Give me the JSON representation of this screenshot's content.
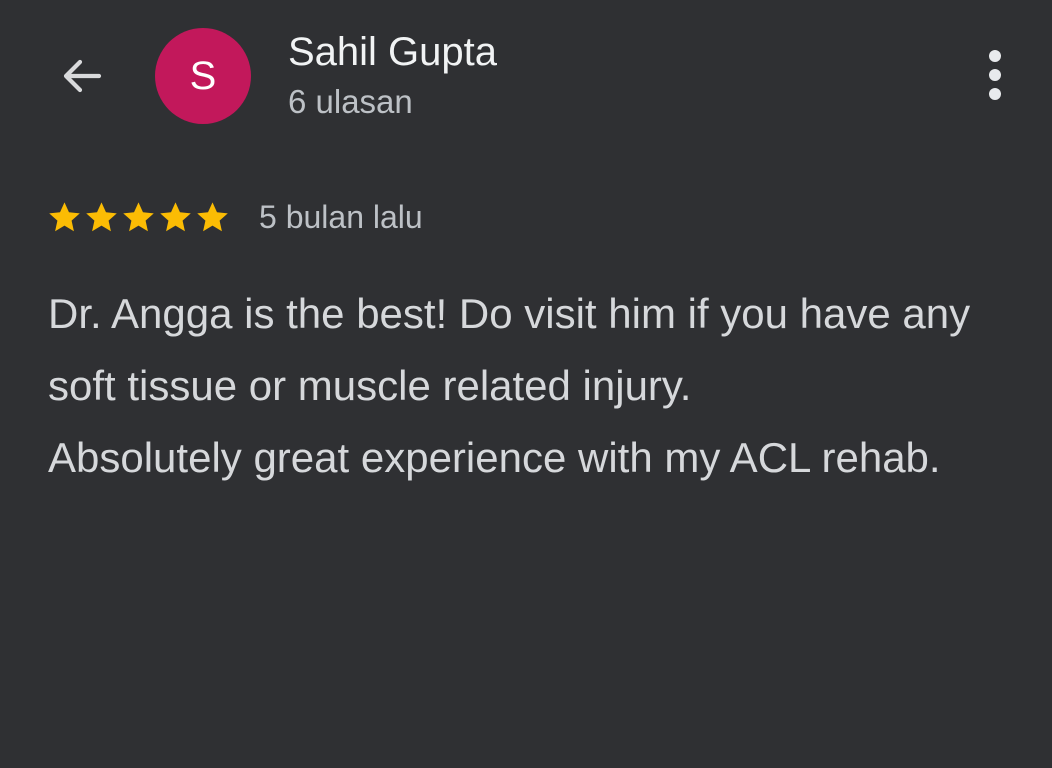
{
  "header": {
    "back_icon": "arrow-left-icon",
    "avatar_initial": "S",
    "avatar_color": "#c2185b",
    "name": "Sahil Gupta",
    "review_count": "6 ulasan",
    "menu_icon": "more-vertical-icon"
  },
  "review": {
    "rating": 5,
    "max_rating": 5,
    "star_color": "#fbbc04",
    "date": "5 bulan lalu",
    "paragraphs": [
      "Dr. Angga is the best! Do visit him if you have any soft tissue or muscle related injury.",
      "Absolutely great experience with my ACL rehab."
    ]
  },
  "theme": {
    "background": "#2f3033",
    "primary_text": "#f1f3f4",
    "secondary_text": "#bdc1c6"
  }
}
